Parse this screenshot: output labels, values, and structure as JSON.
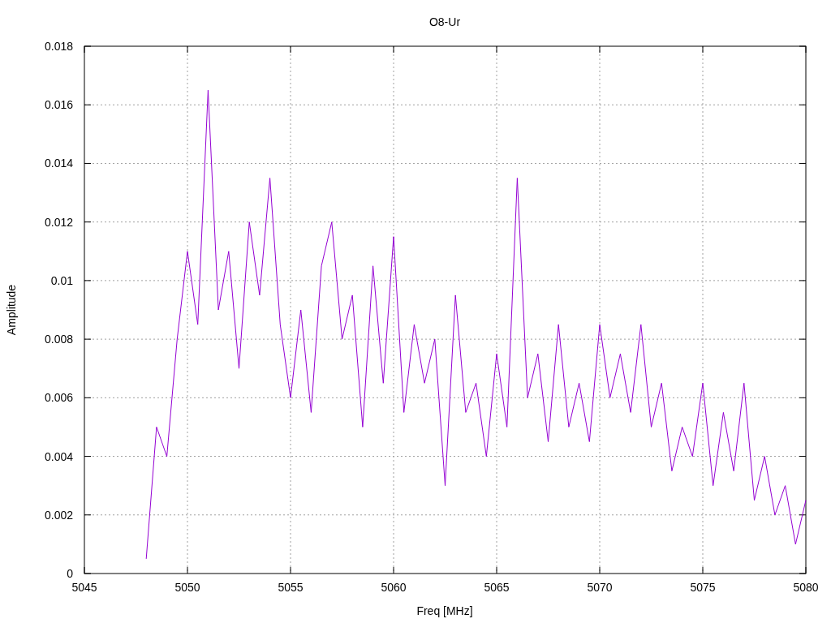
{
  "chart_data": {
    "type": "line",
    "grid": true,
    "title": "O8-Ur",
    "xlabel": "Freq [MHz]",
    "ylabel": "Amplitude",
    "xlim": [
      5045,
      5080
    ],
    "ylim": [
      0,
      0.018
    ],
    "xticks": [
      5045,
      5050,
      5055,
      5060,
      5065,
      5070,
      5075,
      5080
    ],
    "yticks": [
      0,
      0.002,
      0.004,
      0.006,
      0.008,
      0.01,
      0.012,
      0.014,
      0.016,
      0.018
    ],
    "x": [
      5048,
      5048.5,
      5049,
      5049.5,
      5050,
      5050.5,
      5051,
      5051.5,
      5052,
      5052.5,
      5053,
      5053.5,
      5054,
      5054.5,
      5055,
      5055.5,
      5056,
      5056.5,
      5057,
      5057.5,
      5058,
      5058.5,
      5059,
      5059.5,
      5060,
      5060.5,
      5061,
      5061.5,
      5062,
      5062.5,
      5063,
      5063.5,
      5064,
      5064.5,
      5065,
      5065.5,
      5066,
      5066.5,
      5067,
      5067.5,
      5068,
      5068.5,
      5069,
      5069.5,
      5070,
      5070.5,
      5071,
      5071.5,
      5072,
      5072.5,
      5073,
      5073.5,
      5074,
      5074.5,
      5075,
      5075.5,
      5076,
      5076.5,
      5077,
      5077.5,
      5078,
      5078.5,
      5079,
      5079.5,
      5080
    ],
    "series": [
      {
        "color": "#9400d3",
        "values": [
          0.0005,
          0.005,
          0.004,
          0.008,
          0.011,
          0.0085,
          0.0165,
          0.009,
          0.011,
          0.007,
          0.012,
          0.0095,
          0.0135,
          0.0085,
          0.006,
          0.009,
          0.0055,
          0.0105,
          0.012,
          0.008,
          0.0095,
          0.005,
          0.0105,
          0.0065,
          0.0115,
          0.0055,
          0.0085,
          0.0065,
          0.008,
          0.003,
          0.0095,
          0.0055,
          0.0065,
          0.004,
          0.0075,
          0.005,
          0.0135,
          0.006,
          0.0075,
          0.0045,
          0.0085,
          0.005,
          0.0065,
          0.0045,
          0.0085,
          0.006,
          0.0075,
          0.0055,
          0.0085,
          0.005,
          0.0065,
          0.0035,
          0.005,
          0.004,
          0.0065,
          0.003,
          0.0055,
          0.0035,
          0.0065,
          0.0025,
          0.004,
          0.002,
          0.003,
          0.001,
          0.0025
        ]
      }
    ]
  }
}
